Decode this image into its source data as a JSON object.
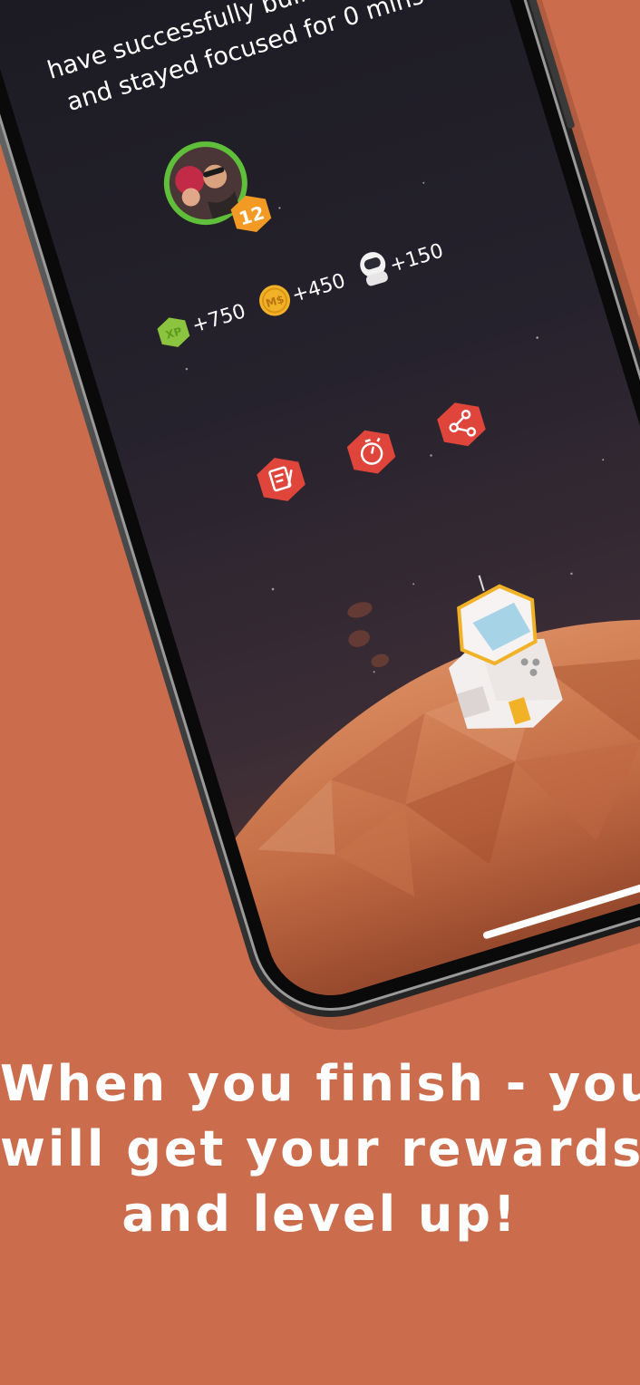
{
  "screen": {
    "message_line_1": "have successfully built Rare La",
    "message_line_2": "and stayed focused for 0 mins",
    "level": "12",
    "rewards": [
      {
        "icon": "xp-badge-icon",
        "badge_text": "XP",
        "value": "+750"
      },
      {
        "icon": "mars-dollar-coin-icon",
        "badge_text": "M$",
        "value": "+450"
      },
      {
        "icon": "astronaut-icon",
        "value": "+150"
      }
    ],
    "actions": [
      {
        "name": "notes-button",
        "icon": "note-edit-icon"
      },
      {
        "name": "timer-button",
        "icon": "stopwatch-icon"
      },
      {
        "name": "share-button",
        "icon": "share-icon"
      }
    ]
  },
  "caption": {
    "line_1": "When you finish - you",
    "line_2": "will get your rewards",
    "line_3": "and level up!"
  },
  "colors": {
    "background": "#cb6d4d",
    "accent_red": "#e0453b",
    "xp_green": "#8bc53f",
    "coin_gold": "#f2b227",
    "level_orange": "#f39a24",
    "avatar_ring": "#5fbf3a"
  }
}
